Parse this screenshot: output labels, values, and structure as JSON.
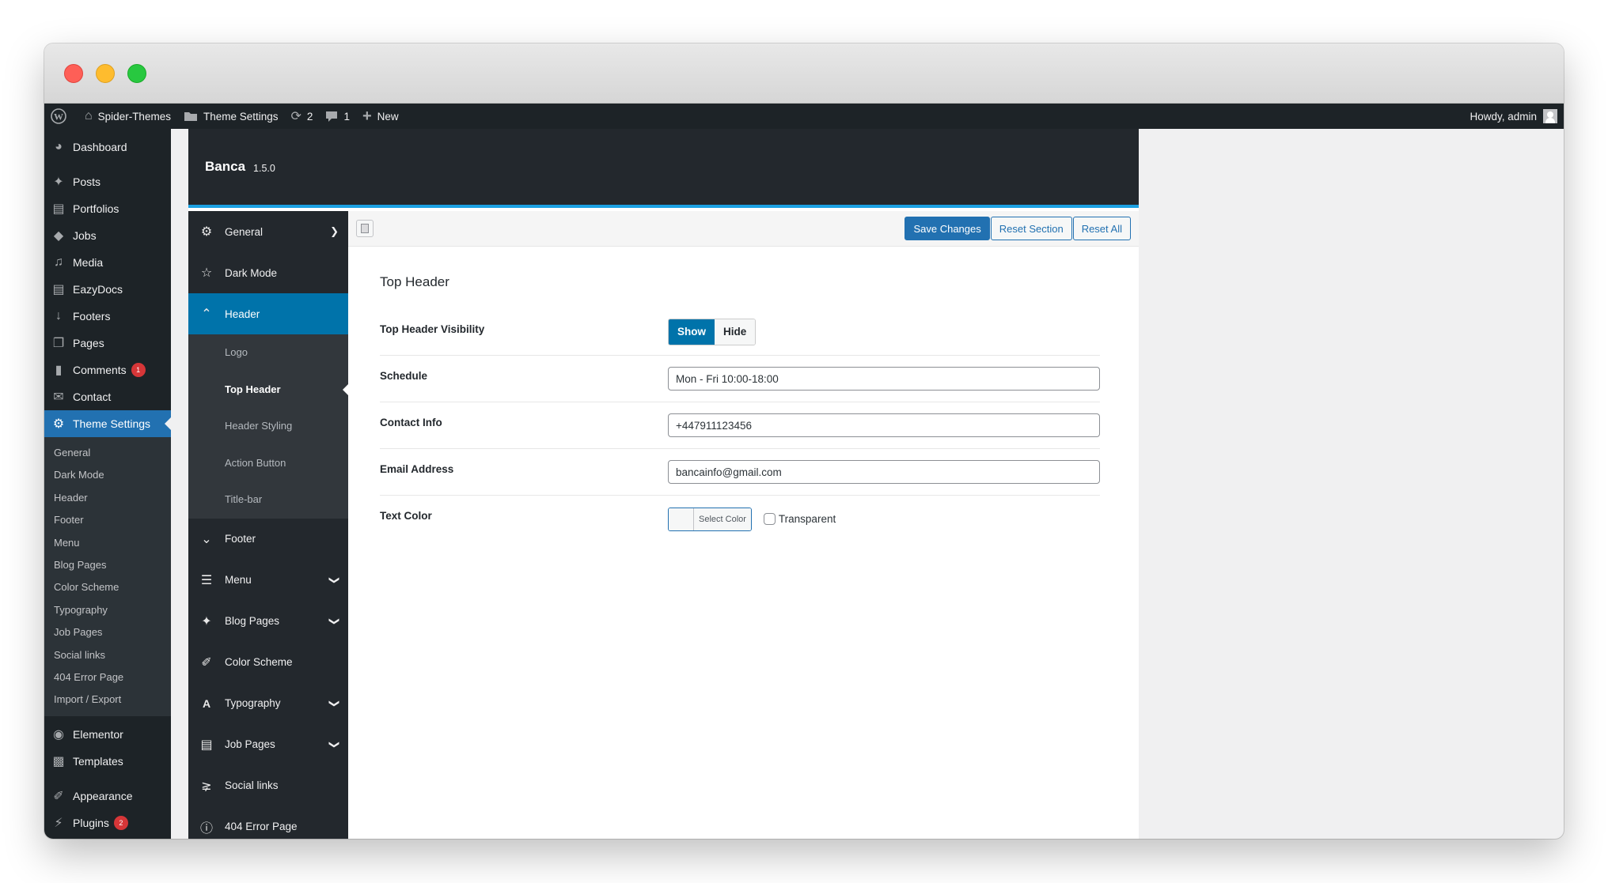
{
  "adminbar": {
    "site_name": "Spider-Themes",
    "theme_settings": "Theme Settings",
    "updates_count": "2",
    "comments_count": "1",
    "new_label": "New",
    "greeting": "Howdy, admin"
  },
  "wp_menu": {
    "items": [
      {
        "label": "Dashboard",
        "icon": "dashboard-icon"
      },
      {
        "label": "Posts",
        "icon": "pin-icon"
      },
      {
        "label": "Portfolios",
        "icon": "portfolio-icon"
      },
      {
        "label": "Jobs",
        "icon": "tag-icon"
      },
      {
        "label": "Media",
        "icon": "media-icon"
      },
      {
        "label": "EazyDocs",
        "icon": "document-icon"
      },
      {
        "label": "Footers",
        "icon": "arrow-down-icon"
      },
      {
        "label": "Pages",
        "icon": "pages-icon"
      },
      {
        "label": "Comments",
        "icon": "comment-icon",
        "badge": "1"
      },
      {
        "label": "Contact",
        "icon": "mail-icon"
      },
      {
        "label": "Theme Settings",
        "icon": "gear-icon"
      }
    ],
    "submenu": [
      "General",
      "Dark Mode",
      "Header",
      "Footer",
      "Menu",
      "Blog Pages",
      "Color Scheme",
      "Typography",
      "Job Pages",
      "Social links",
      "404 Error Page",
      "Import / Export"
    ],
    "bottom_items": [
      {
        "label": "Elementor",
        "icon": "elementor-icon"
      },
      {
        "label": "Templates",
        "icon": "folder-icon"
      },
      {
        "label": "Appearance",
        "icon": "paintbrush-icon"
      },
      {
        "label": "Plugins",
        "icon": "plugin-icon",
        "badge": "2"
      }
    ]
  },
  "redux": {
    "title": "Banca",
    "version": "1.5.0",
    "sidebar": {
      "general": "General",
      "dark_mode": "Dark Mode",
      "header": "Header",
      "header_sub": [
        "Logo",
        "Top Header",
        "Header Styling",
        "Action Button",
        "Title-bar"
      ],
      "footer": "Footer",
      "menu": "Menu",
      "blog_pages": "Blog Pages",
      "color_scheme": "Color Scheme",
      "typography": "Typography",
      "job_pages": "Job Pages",
      "social_links": "Social links",
      "error_page": "404 Error Page"
    },
    "toolbar": {
      "save": "Save Changes",
      "reset_section": "Reset Section",
      "reset_all": "Reset All"
    },
    "section": {
      "title": "Top Header",
      "fields": {
        "visibility": {
          "label": "Top Header Visibility",
          "options": [
            "Show",
            "Hide"
          ],
          "selected": "Show"
        },
        "schedule": {
          "label": "Schedule",
          "value": "Mon - Fri 10:00-18:00"
        },
        "contact": {
          "label": "Contact Info",
          "value": "+447911123456"
        },
        "email": {
          "label": "Email Address",
          "value": "bancainfo@gmail.com"
        },
        "text_color": {
          "label": "Text Color",
          "button": "Select Color",
          "transparent_label": "Transparent",
          "transparent_checked": false
        }
      }
    }
  },
  "colors": {
    "admin_dark": "#1d2327",
    "accent_blue": "#2271b1",
    "redux_active": "#0073aa",
    "redux_line": "#1ba1e2",
    "badge_red": "#d63638"
  }
}
